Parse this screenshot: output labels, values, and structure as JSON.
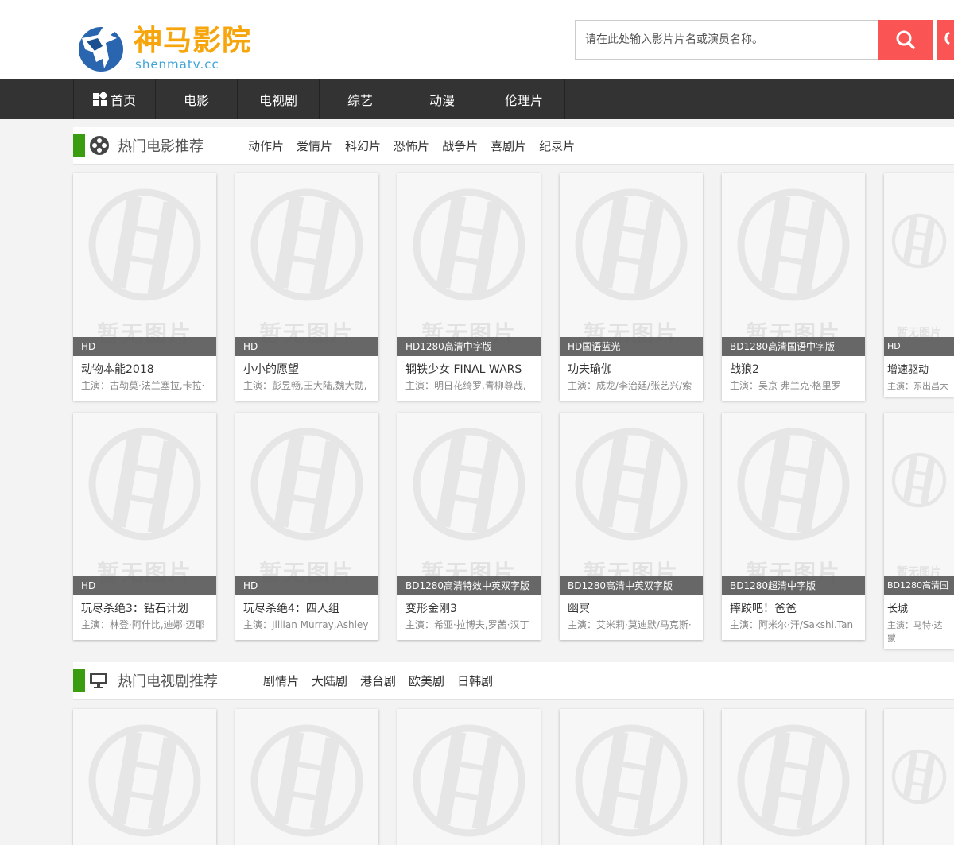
{
  "site": {
    "name": "神马影院",
    "domain": "shenmatv.cc"
  },
  "search": {
    "placeholder": "请在此处输入影片片名或演员名称。"
  },
  "nav": [
    "首页",
    "电影",
    "电视剧",
    "综艺",
    "动漫",
    "伦理片"
  ],
  "no_image_text": "暂无图片",
  "colors": {
    "accent": "#3a9d10",
    "search": "#fb5454",
    "nav": "#333333",
    "logo": "#f7a50c"
  },
  "movies": {
    "title": "热门电影推荐",
    "links": [
      "动作片",
      "爱情片",
      "科幻片",
      "恐怖片",
      "战争片",
      "喜剧片",
      "纪录片"
    ],
    "items": [
      {
        "tag": "HD",
        "title": "动物本能2018",
        "actors": "主演：古勒莫·法兰塞拉,卡拉·"
      },
      {
        "tag": "HD",
        "title": "小小的愿望",
        "actors": "主演：彭昱畅,王大陆,魏大勋,"
      },
      {
        "tag": "HD1280高清中字版",
        "title": "钢铁少女 FINAL WARS",
        "actors": "主演：明日花绮罗,青柳尊哉,"
      },
      {
        "tag": "HD国语蓝光",
        "title": "功夫瑜伽",
        "actors": "主演：成龙/李治廷/张艺兴/索"
      },
      {
        "tag": "BD1280高清国语中字版",
        "title": "战狼2",
        "actors": "主演：吴京 弗兰克·格里罗"
      },
      {
        "tag": "HD",
        "title": "增速驱动",
        "actors": "主演：东出昌大"
      },
      {
        "tag": "HD",
        "title": "玩尽杀绝3：钻石计划",
        "actors": "主演：林登·阿什比,迪娜·迈耶"
      },
      {
        "tag": "HD",
        "title": "玩尽杀绝4：四人组",
        "actors": "主演：Jillian Murray,Ashley"
      },
      {
        "tag": "BD1280高清特效中英双字版",
        "title": "变形金刚3",
        "actors": "主演：希亚·拉博夫,罗茜·汉丁"
      },
      {
        "tag": "BD1280高清中英双字版",
        "title": "幽冥",
        "actors": "主演：艾米莉·莫迪默/马克斯·"
      },
      {
        "tag": "BD1280超清中字版",
        "title": "摔跤吧！爸爸",
        "actors": "主演：阿米尔·汗/Sakshi.Tan"
      },
      {
        "tag": "BD1280高清国",
        "title": "长城",
        "actors": "主演：马特·达蒙"
      }
    ]
  },
  "tv": {
    "title": "热门电视剧推荐",
    "links": [
      "剧情片",
      "大陆剧",
      "港台剧",
      "欧美剧",
      "日韩剧"
    ]
  }
}
